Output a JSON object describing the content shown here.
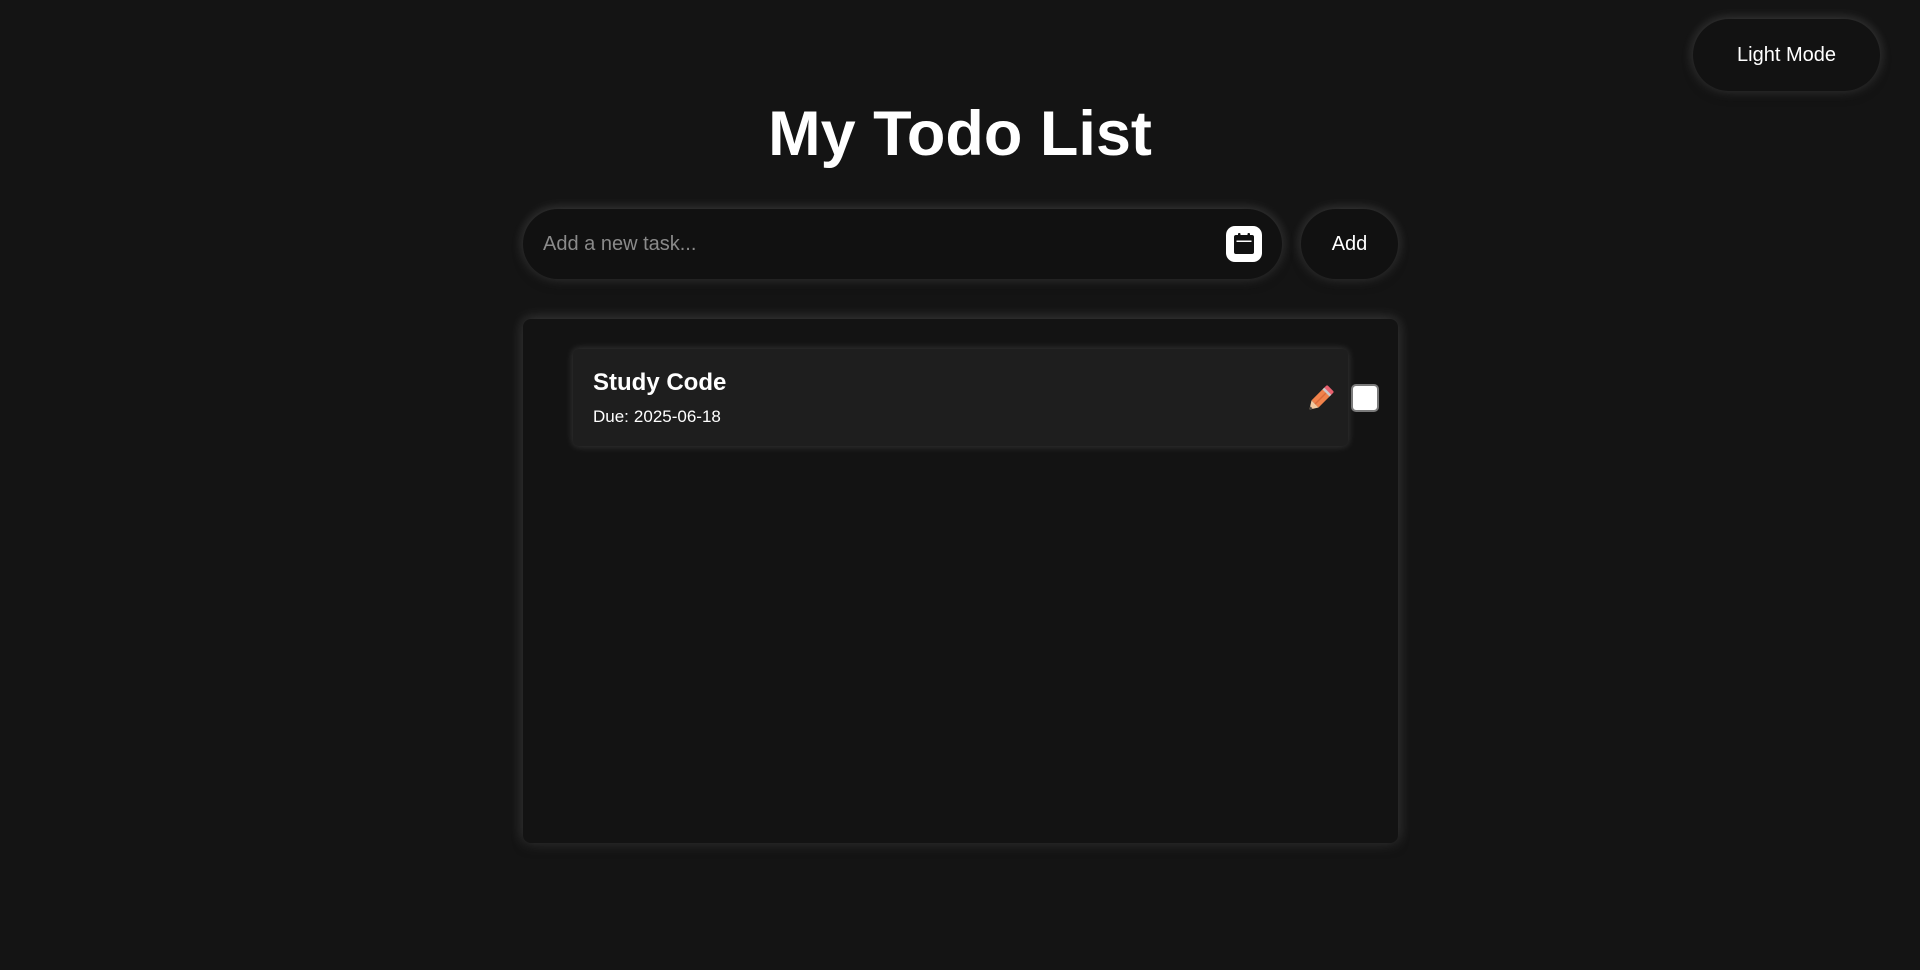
{
  "header": {
    "mode_toggle_label": "Light Mode",
    "title": "My Todo List"
  },
  "new_task": {
    "placeholder": "Add a new task...",
    "value": "",
    "date_picker_icon": "calendar-icon",
    "add_label": "Add"
  },
  "todos": [
    {
      "title": "Study Code",
      "due_label": "Due:",
      "due_date": "2025-06-18",
      "completed": false,
      "edit_icon": "pencil-icon"
    }
  ],
  "colors": {
    "background": "#141414",
    "surface": "#1e1e1e",
    "text": "#ffffff",
    "placeholder": "#8a8a8a",
    "edit_icon": "#f0824b"
  }
}
